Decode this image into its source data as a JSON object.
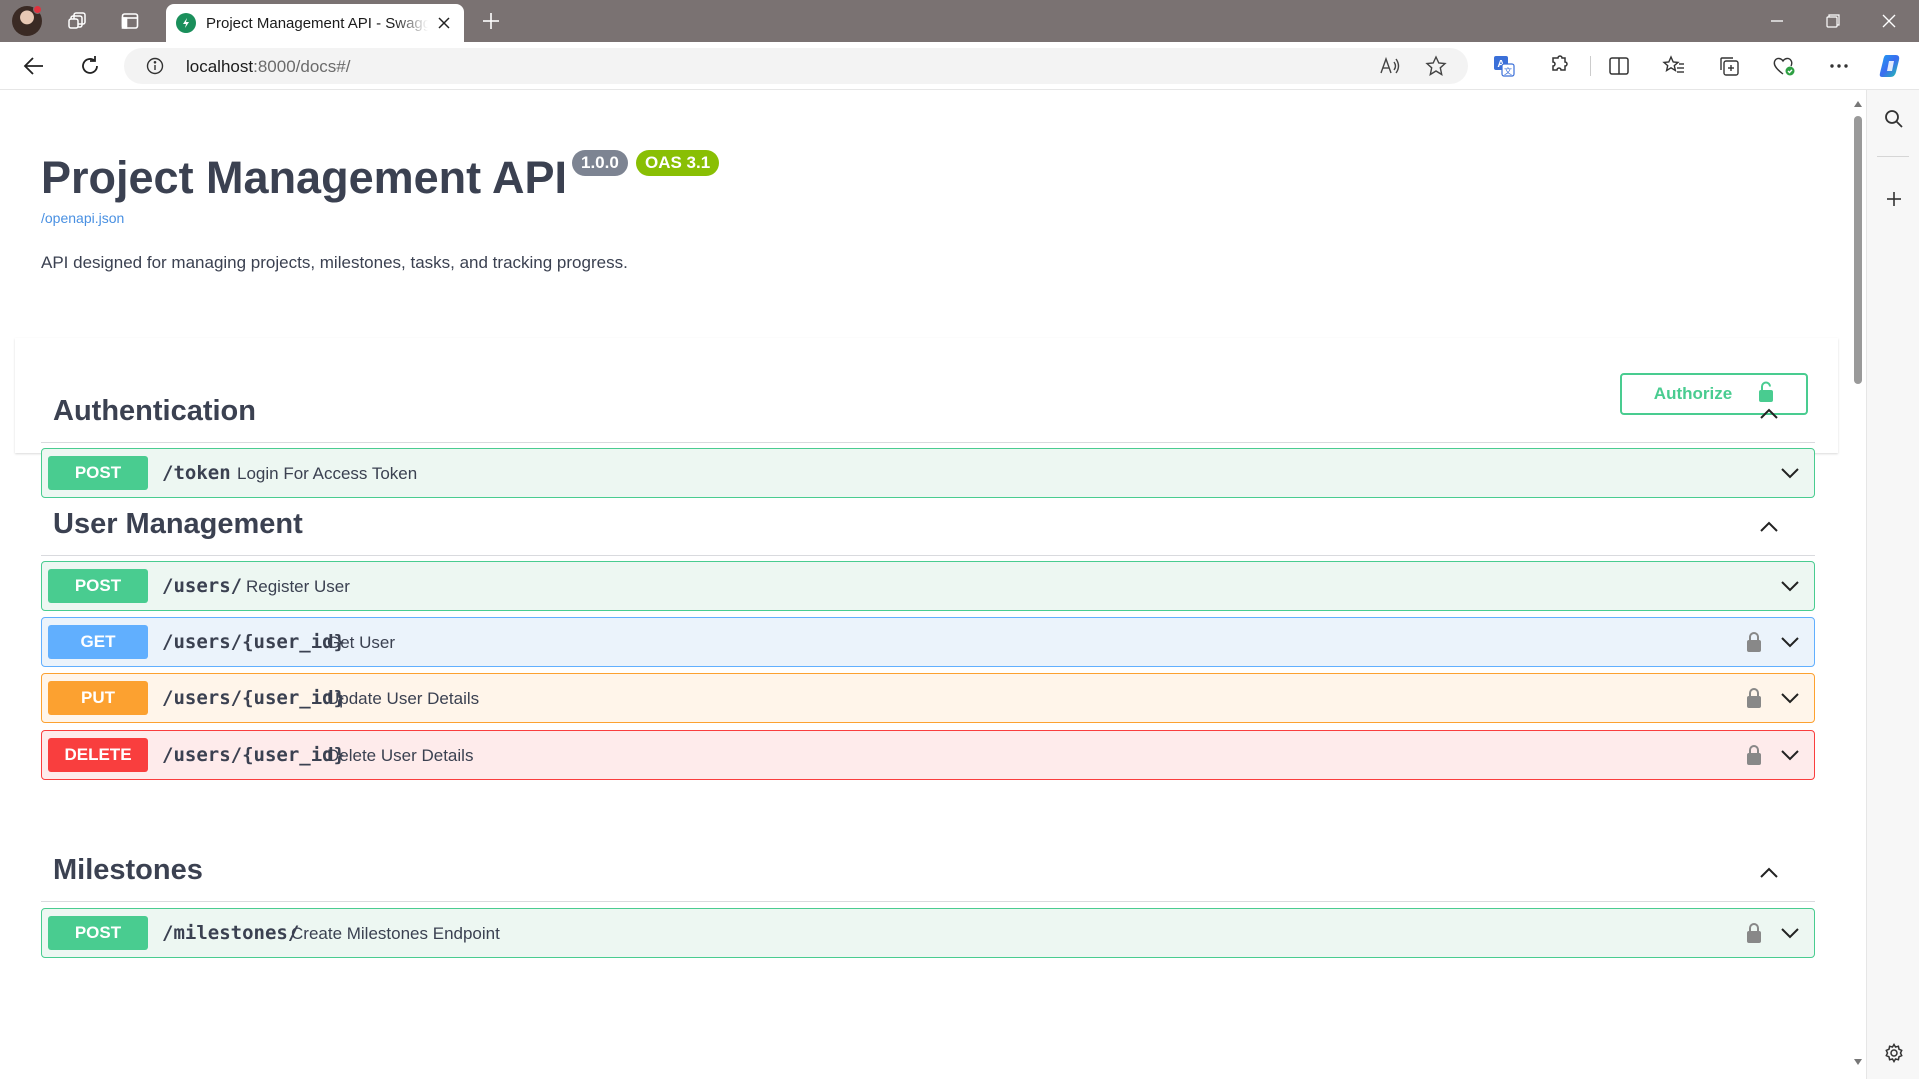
{
  "browser": {
    "tab_title": "Project Management API - Swagger UI",
    "url_host": "localhost",
    "url_rest": ":8000/docs#/"
  },
  "info": {
    "title": "Project Management API",
    "version_badge": "1.0.0",
    "oas_badge": "OAS 3.1",
    "spec_link": "/openapi.json",
    "description": "API designed for managing projects, milestones, tasks, and tracking progress."
  },
  "authorize": {
    "label": "Authorize"
  },
  "tags": [
    {
      "name": "Authentication"
    },
    {
      "name": "User Management"
    },
    {
      "name": "Milestones"
    }
  ],
  "operations": [
    {
      "method": "POST",
      "path": "/token",
      "summary": "Login For Access Token"
    },
    {
      "method": "POST",
      "path": "/users/",
      "summary": "Register User"
    },
    {
      "method": "GET",
      "path": "/users/{user_id}",
      "summary": "Get User"
    },
    {
      "method": "PUT",
      "path": "/users/{user_id}",
      "summary": "Update User Details"
    },
    {
      "method": "DELETE",
      "path": "/users/{user_id}",
      "summary": "Delete User Details"
    },
    {
      "method": "POST",
      "path": "/milestones/",
      "summary": "Create Milestones Endpoint"
    }
  ],
  "colors": {
    "post": "#49cc90",
    "get": "#61affe",
    "put": "#fca130",
    "delete": "#f93e3e",
    "title_text": "#3b4151",
    "link": "#4990e2",
    "badge_version": "#7d8492",
    "badge_oas": "#89bf04"
  }
}
